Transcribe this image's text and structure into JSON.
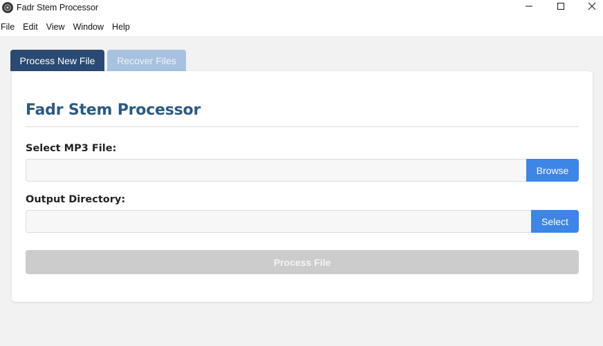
{
  "window": {
    "title": "Fadr Stem Processor",
    "app_icon": "app-logo-icon",
    "controls": {
      "minimize_icon": "minimize-icon",
      "maximize_icon": "maximize-icon",
      "close_icon": "close-icon"
    }
  },
  "menubar": {
    "items": [
      "File",
      "Edit",
      "View",
      "Window",
      "Help"
    ]
  },
  "tabs": [
    {
      "label": "Process New File",
      "active": true
    },
    {
      "label": "Recover Files",
      "active": false
    }
  ],
  "main": {
    "heading": "Fadr Stem Processor",
    "mp3_field": {
      "label": "Select MP3 File:",
      "value": "",
      "button_label": "Browse"
    },
    "output_field": {
      "label": "Output Directory:",
      "value": "",
      "button_label": "Select"
    },
    "process_button": {
      "label": "Process File",
      "disabled": true
    }
  },
  "colors": {
    "tab_active_bg": "#2a4a73",
    "tab_inactive_bg": "#a7c2df",
    "heading": "#2b5a82",
    "primary_button": "#3d85e6",
    "disabled_button": "#cccccc"
  }
}
